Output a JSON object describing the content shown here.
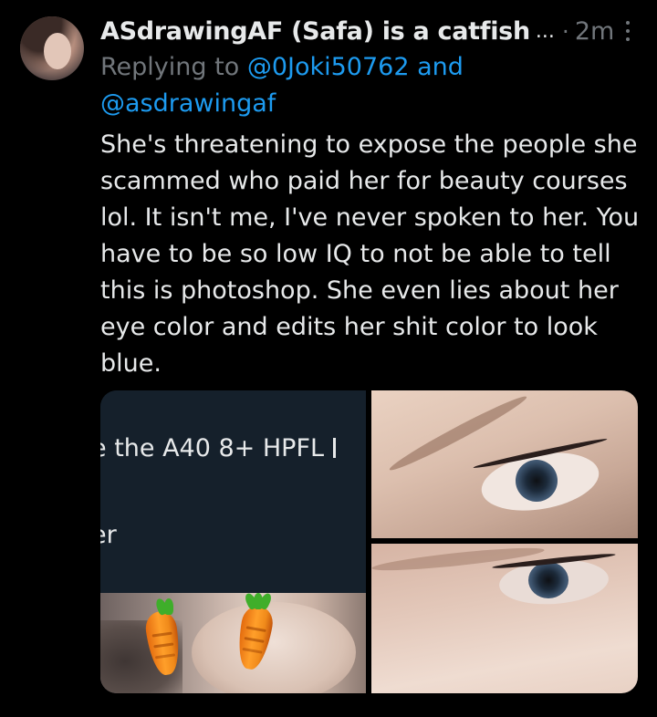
{
  "tweet": {
    "display_name": "ASdrawingAF (Safa) is a catfish",
    "name_truncation": "...",
    "separator": "·",
    "time": "2m",
    "replying_prefix": "Replying to",
    "replying_mention_1": "@0Joki50762",
    "replying_conjunction": "and",
    "replying_mention_2": "@asdrawingaf",
    "text": "She's threatening to expose the people she scammed who paid her for beauty courses lol. It isn't me, I've never spoken to her. You have to be so low IQ to not be able to tell this is photoshop. She even lies about her eye color and edits her shit color to look blue."
  },
  "media": {
    "left_tile": {
      "line1": "e the A40 8+ HPFL",
      "line2": "er"
    }
  },
  "icons": {
    "more": "more-vertical-icon"
  },
  "colors": {
    "background": "#000000",
    "text_primary": "#e7e9ea",
    "text_secondary": "#71767b",
    "link": "#1d9bf0"
  }
}
